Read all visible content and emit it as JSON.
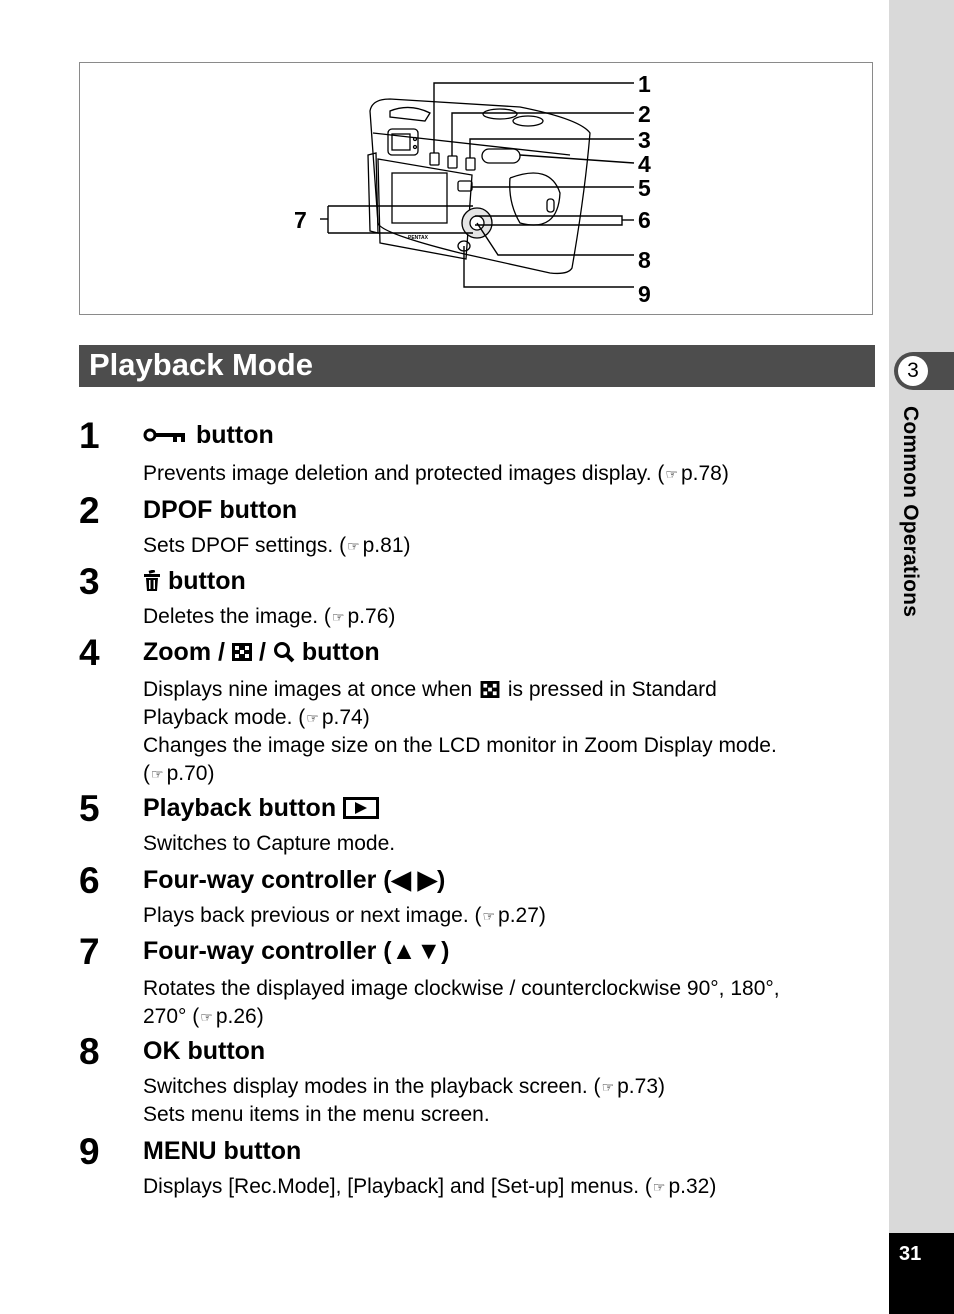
{
  "figure": {
    "callouts": [
      "1",
      "2",
      "3",
      "4",
      "5",
      "6",
      "7",
      "8",
      "9"
    ],
    "camera_brand": "PENTAX"
  },
  "section": {
    "title": "Playback Mode"
  },
  "items": [
    {
      "number": "1",
      "icon": "protect-key-icon",
      "title": "button",
      "lines": [
        {
          "text": "Prevents image deletion and protected images display. (",
          "ref": "p.78"
        }
      ]
    },
    {
      "number": "2",
      "title": "DPOF button",
      "lines": [
        {
          "text": "Sets DPOF settings. (",
          "ref": "p.81"
        }
      ]
    },
    {
      "number": "3",
      "icon": "trash-icon",
      "title": "button",
      "lines": [
        {
          "text": "Deletes the image. (",
          "ref": "p.76"
        }
      ]
    },
    {
      "number": "4",
      "title_parts": [
        "Zoom /",
        "/",
        "button"
      ],
      "lines": [
        {
          "text_before": "Displays nine images at once when",
          "text_after": "is pressed in Standard"
        },
        {
          "text": "Playback mode. (",
          "ref": "p.74"
        },
        {
          "text": "Changes the image size on the LCD monitor in Zoom Display mode."
        },
        {
          "text": "(",
          "ref": "p.70"
        }
      ]
    },
    {
      "number": "5",
      "title": "Playback button",
      "icon": "playback-icon",
      "lines": [
        {
          "text": "Switches to Capture mode."
        }
      ]
    },
    {
      "number": "6",
      "title": "Four-way controller (◀ ▶)",
      "lines": [
        {
          "text": "Plays back previous or next image. (",
          "ref": "p.27"
        }
      ]
    },
    {
      "number": "7",
      "title": "Four-way controller (▲▼)",
      "lines": [
        {
          "text": "Rotates the displayed image clockwise / counterclockwise 90°, 180°,"
        },
        {
          "text": "270° (",
          "ref": "p.26"
        }
      ]
    },
    {
      "number": "8",
      "title": "OK button",
      "lines": [
        {
          "text": "Switches display modes in the playback screen. (",
          "ref": "p.73"
        },
        {
          "text": "Sets menu items in the menu screen."
        }
      ]
    },
    {
      "number": "9",
      "title": "MENU button",
      "lines": [
        {
          "text": "Displays [Rec.Mode], [Playback] and [Set-up] menus. (",
          "ref": "p.32"
        }
      ]
    }
  ],
  "ref_symbol": "☞",
  "ref_close": ")",
  "sidebar": {
    "chapter_number": "3",
    "chapter_title": "Common Operations",
    "page_number": "31"
  }
}
